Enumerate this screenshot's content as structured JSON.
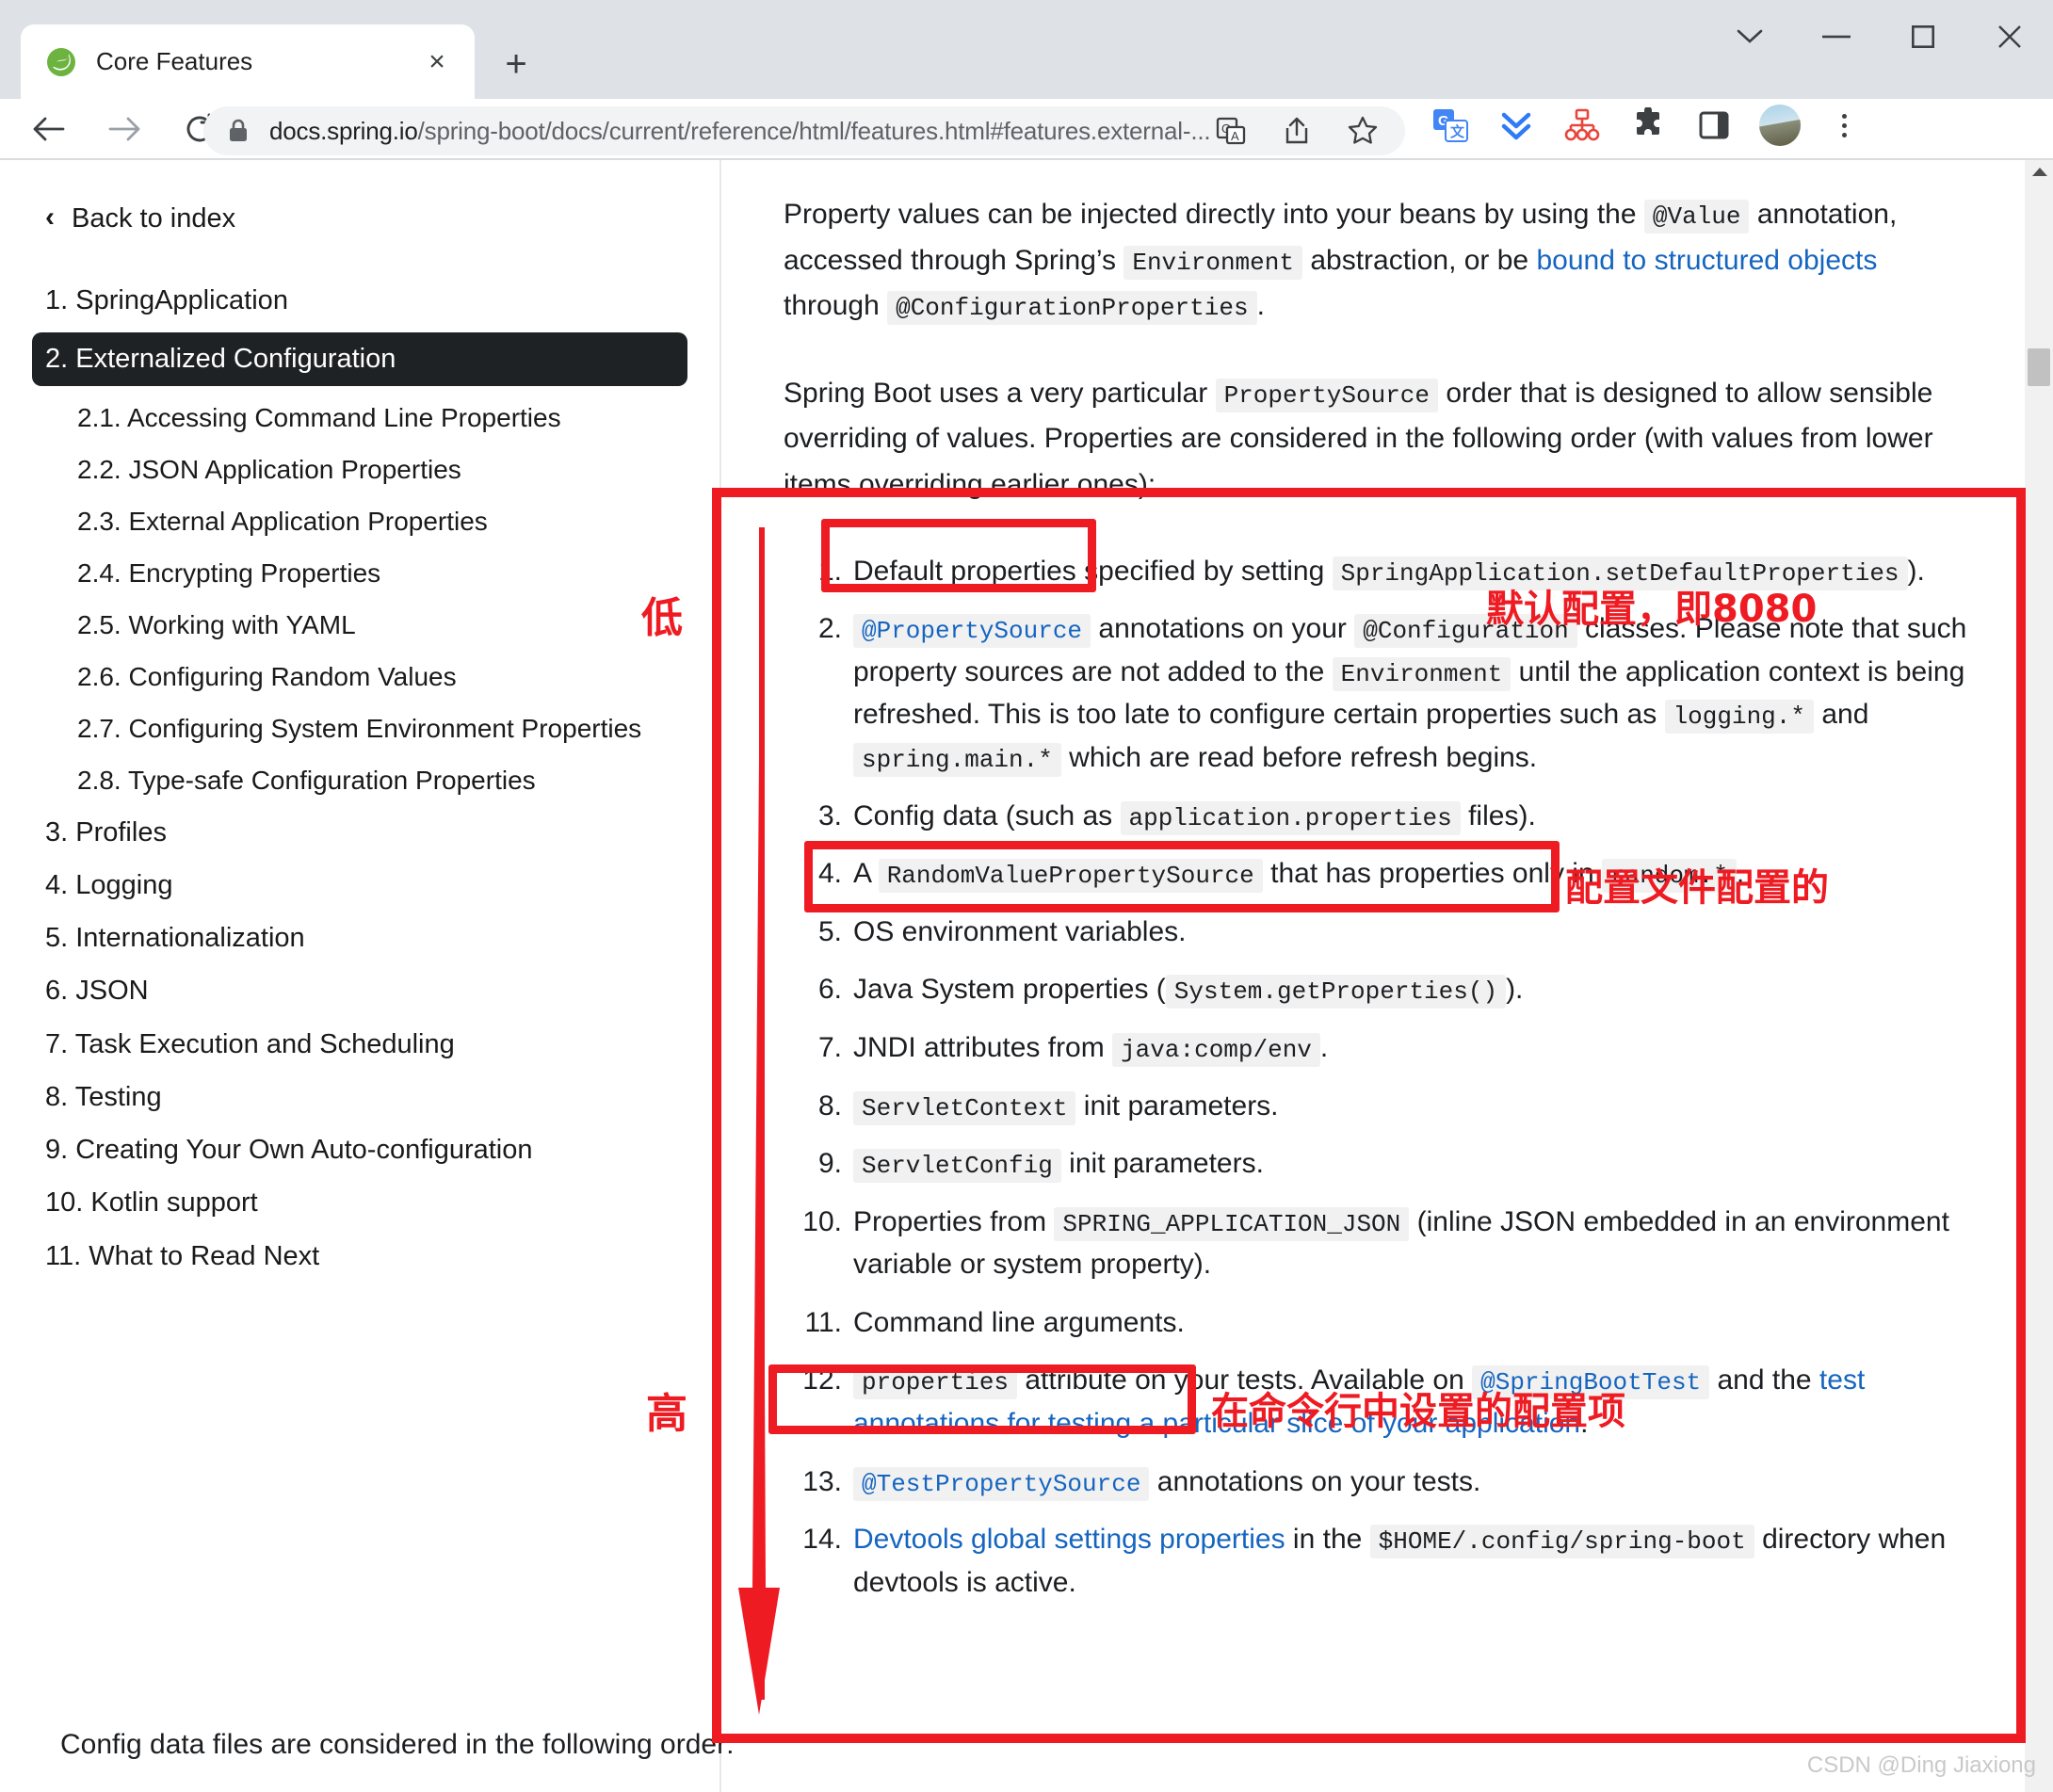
{
  "browser": {
    "tab": {
      "title": "Core Features",
      "favicon": "spring-leaf-icon",
      "close_label": "×"
    },
    "new_tab_label": "+",
    "window_controls": {
      "minimize_group": "⌄",
      "minimize": "—",
      "maximize": "□",
      "close": "✕"
    },
    "nav": {
      "back": "←",
      "forward": "→",
      "reload": "⟳"
    },
    "address": {
      "lock_icon": "lock-icon",
      "host": "docs.spring.io",
      "path": "/spring-boot/docs/current/reference/html/features.html#features.external-...",
      "full": "docs.spring.io/spring-boot/docs/current/reference/html/features.html#features.external-..."
    },
    "toolbar_icons": [
      "translate-page-icon",
      "share-icon",
      "bookmark-star-icon",
      "google-translate-extension-icon",
      "download-manager-icon",
      "sitemap-extension-icon",
      "extensions-puzzle-icon",
      "side-panel-icon",
      "profile-avatar",
      "chrome-menu-icon"
    ]
  },
  "sidebar": {
    "back_to_index": "Back to index",
    "back_icon": "chevron-left-icon",
    "items": [
      {
        "label": "1. SpringApplication",
        "level": 1,
        "active": false
      },
      {
        "label": "2. Externalized Configuration",
        "level": 1,
        "active": true
      },
      {
        "label": "2.1. Accessing Command Line Properties",
        "level": 2,
        "active": false
      },
      {
        "label": "2.2. JSON Application Properties",
        "level": 2,
        "active": false
      },
      {
        "label": "2.3. External Application Properties",
        "level": 2,
        "active": false
      },
      {
        "label": "2.4. Encrypting Properties",
        "level": 2,
        "active": false
      },
      {
        "label": "2.5. Working with YAML",
        "level": 2,
        "active": false
      },
      {
        "label": "2.6. Configuring Random Values",
        "level": 2,
        "active": false
      },
      {
        "label": "2.7. Configuring System Environment Properties",
        "level": 2,
        "active": false
      },
      {
        "label": "2.8. Type-safe Configuration Properties",
        "level": 2,
        "active": false
      },
      {
        "label": "3. Profiles",
        "level": 1,
        "active": false
      },
      {
        "label": "4. Logging",
        "level": 1,
        "active": false
      },
      {
        "label": "5. Internationalization",
        "level": 1,
        "active": false
      },
      {
        "label": "6. JSON",
        "level": 1,
        "active": false
      },
      {
        "label": "7. Task Execution and Scheduling",
        "level": 1,
        "active": false
      },
      {
        "label": "8. Testing",
        "level": 1,
        "active": false
      },
      {
        "label": "9. Creating Your Own Auto-configuration",
        "level": 1,
        "active": false
      },
      {
        "label": "10. Kotlin support",
        "level": 1,
        "active": false
      },
      {
        "label": "11. What to Read Next",
        "level": 1,
        "active": false
      }
    ]
  },
  "content": {
    "paragraph1": {
      "p1": "Property values can be injected directly into your beans by using the ",
      "c1": "@Value",
      "p2": " annotation, accessed through Spring’s ",
      "c2": "Environment",
      "p3": " abstraction, or be ",
      "link1": "bound to structured objects",
      "p4": " through ",
      "c3": "@ConfigurationProperties",
      "p5": "."
    },
    "paragraph2": {
      "p1": "Spring Boot uses a very particular ",
      "c1": "PropertySource",
      "p2": " order that is designed to allow sensible overriding of values. Properties are considered in the following order (with values from lower items overriding earlier ones):"
    },
    "list": [
      {
        "n": 1,
        "html_key": "item1",
        "text": "Default properties specified by setting SpringApplication.setDefaultProperties )."
      },
      {
        "n": 2,
        "html_key": "item2",
        "text": "@PropertySource annotations on your @Configuration classes. Please note that such property sources are not added to the Environment until the application context is being refreshed. This is too late to configure certain properties such as logging.* and spring.main.* which are read before refresh begins."
      },
      {
        "n": 3,
        "html_key": "item3",
        "text": "Config data (such as application.properties files)."
      },
      {
        "n": 4,
        "html_key": "item4",
        "text": "A RandomValuePropertySource that has properties only in random.*."
      },
      {
        "n": 5,
        "html_key": "item5",
        "text": "OS environment variables."
      },
      {
        "n": 6,
        "html_key": "item6",
        "text": "Java System properties ( System.getProperties() )."
      },
      {
        "n": 7,
        "html_key": "item7",
        "text": "JNDI attributes from java:comp/env ."
      },
      {
        "n": 8,
        "html_key": "item8",
        "text": "ServletContext init parameters."
      },
      {
        "n": 9,
        "html_key": "item9",
        "text": "ServletConfig init parameters."
      },
      {
        "n": 10,
        "html_key": "item10",
        "text": "Properties from SPRING_APPLICATION_JSON (inline JSON embedded in an environment variable or system property)."
      },
      {
        "n": 11,
        "html_key": "item11",
        "text": "Command line arguments."
      },
      {
        "n": 12,
        "html_key": "item12",
        "text": "properties attribute on your tests. Available on @SpringBootTest and the test annotations for testing a particular slice of your application."
      },
      {
        "n": 13,
        "html_key": "item13",
        "text": "@TestPropertySource annotations on your tests."
      },
      {
        "n": 14,
        "html_key": "item14",
        "text": "Devtools global settings properties in the $HOME/.config/spring-boot directory when devtools is active."
      }
    ],
    "fragments": {
      "i1_a": "Default properties",
      "i1_b": " specified by setting ",
      "i1_code": "SpringApplication.setDefaultProperties",
      "i1_c": ").",
      "i2_code1": "@PropertySource",
      "i2_a": " annotations on your ",
      "i2_code2": "@Configuration",
      "i2_b": " classes. Please note that such property sources are not added to the ",
      "i2_code3": "Environment",
      "i2_c": " until the application context is being refreshed. This is too late to configure certain properties such as ",
      "i2_code4": "logging.*",
      "i2_d": " and ",
      "i2_code5": "spring.main.*",
      "i2_e": " which are read before refresh begins.",
      "i3_a": "Config data (such as ",
      "i3_code": "application.properties",
      "i3_b": " files).",
      "i4_a": "A ",
      "i4_code1": "RandomValuePropertySource",
      "i4_b": " that has properties only in ",
      "i4_code2": "random.*",
      "i4_c": ".",
      "i5_a": "OS environment variables.",
      "i6_a": "Java System properties (",
      "i6_code": "System.getProperties()",
      "i6_b": ").",
      "i7_a": "JNDI attributes from ",
      "i7_code": "java:comp/env",
      "i7_b": ".",
      "i8_code": "ServletContext",
      "i8_a": " init parameters.",
      "i9_code": "ServletConfig",
      "i9_a": " init parameters.",
      "i10_a": "Properties from ",
      "i10_code": "SPRING_APPLICATION_JSON",
      "i10_b": " (inline JSON embedded in an environment variable or system property).",
      "i11_a": "Command line arguments.",
      "i12_code": "properties",
      "i12_a": " attribute on your tests. Available on ",
      "i12_code2": "@SpringBootTest",
      "i12_b": " and the ",
      "i12_link": "test annotations for testing a particular slice of your application",
      "i12_c": ".",
      "i13_code": "@TestPropertySource",
      "i13_a": " annotations on your tests.",
      "i14_link": "Devtools global settings properties",
      "i14_a": " in the ",
      "i14_code": "$HOME/.config/spring-boot",
      "i14_b": " directory when devtools is active."
    },
    "cut_off_line": "Config data files are considered in the following order:"
  },
  "annotations": {
    "color": "#ee1b23",
    "low_label": "低",
    "high_label": "高",
    "note_default": "默认配置，即8080",
    "note_config_file": "配置文件配置的",
    "note_command_line": "在命令行中设置的配置项",
    "arrow": "downward-arrow"
  },
  "watermark": "CSDN @Ding Jiaxiong"
}
